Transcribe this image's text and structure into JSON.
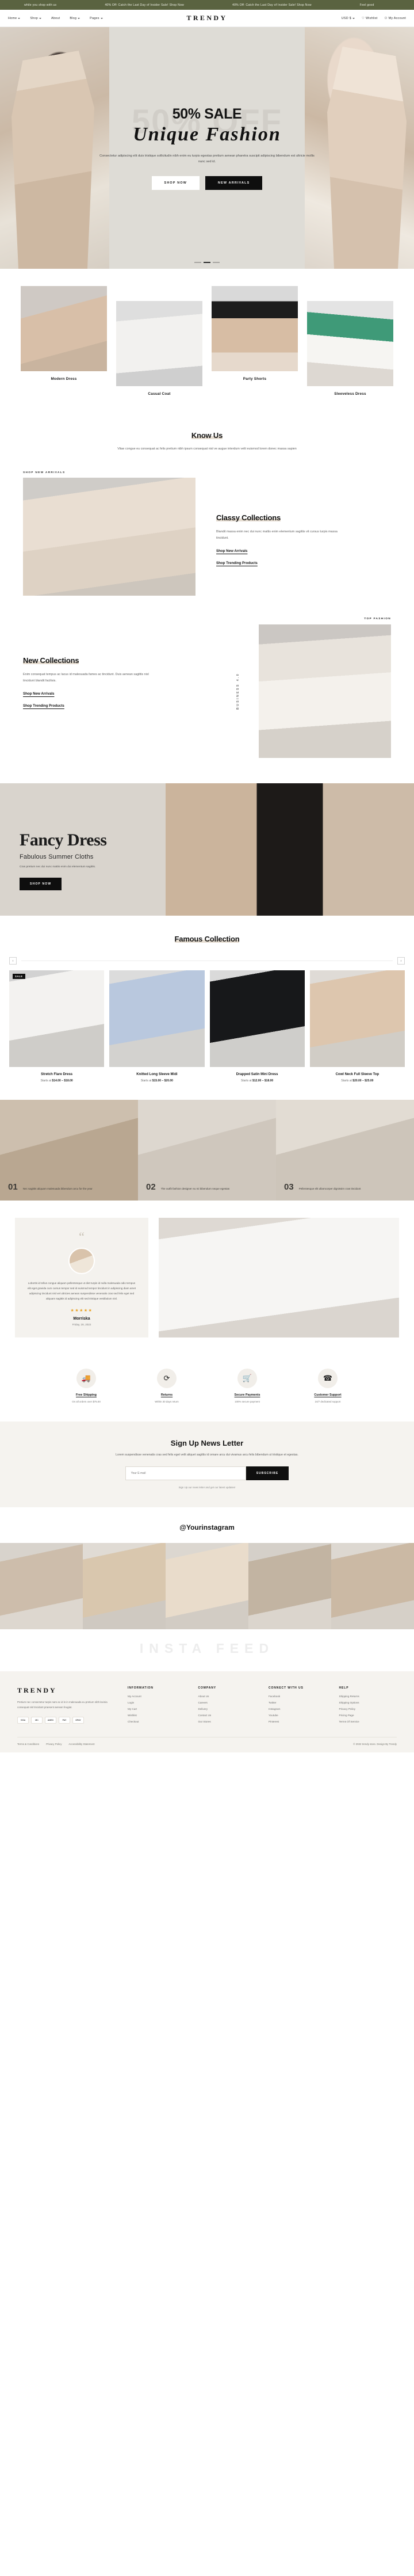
{
  "announcement": {
    "messages": [
      "while you shop with us",
      "40% Off: Catch the Last Day of Insider Sale! Shop Now",
      "40% Off: Catch the Last Day of Insider Sale! Shop Now",
      "Feel good"
    ]
  },
  "header": {
    "logo": "TRENDY",
    "nav": [
      {
        "label": "Home",
        "caret": true
      },
      {
        "label": "Shop",
        "caret": true
      },
      {
        "label": "About",
        "caret": false
      },
      {
        "label": "Blog",
        "caret": true
      },
      {
        "label": "Pages",
        "caret": true
      }
    ],
    "right": [
      {
        "label": "USD $",
        "name": "currency-select",
        "caret": true
      },
      {
        "label": "Wishlist",
        "name": "wishlist-link",
        "icon": "heart-icon"
      },
      {
        "label": "My Account",
        "name": "account-link",
        "icon": "user-icon"
      }
    ]
  },
  "hero": {
    "ghost": "50% OFF",
    "title": "50% SALE",
    "script": "Unique Fashion",
    "subtitle": "Consectetur adipiscing elit duis tristique sollicitudin nibh enim eu turpis egestas pretium aenean pharetra suscipit adipiscing bibendum est ultricie mollis nunc sed id.",
    "primary_button": "SHOP NOW",
    "secondary_button": "NEW ARRIVALS",
    "slides": 3,
    "active_slide": 1
  },
  "categories": [
    {
      "label": "Modern Dress",
      "name": "category-modern-dress"
    },
    {
      "label": "Casual Coat",
      "name": "category-casual-coat"
    },
    {
      "label": "Party Shorts",
      "name": "category-party-shorts"
    },
    {
      "label": "Sleeveless Dress",
      "name": "category-sleeveless-dress"
    }
  ],
  "know_us": {
    "title": "Know Us",
    "text": "Vitae congue eu consequat ac felis pretium nibh ipsum consequat nisl ve augue interdum velit euismod lorem donec massa sapien"
  },
  "classy": {
    "tag": "SHOP NEW ARRIVALS",
    "title": "Classy Collections",
    "text": "Blandit massa enim nec dui nunc mattis enim elementum sagittis vit cursus turpis massa tincidunt.",
    "link1": "Shop New Arrivals",
    "link2": "Shop Trending Products"
  },
  "new_collections": {
    "tag": "TOP FASHION",
    "vertical": "BUSINESS 4.0",
    "title": "New Collections",
    "text": "Enim consequat tempus ac lacus id malesuada fames ac tincidunt. Duis aenean sagittis nisl tincidunt blandit facilisis.",
    "link1": "Shop New Arrivals",
    "link2": "Shop Trending Products"
  },
  "fancy": {
    "title": "Fancy Dress",
    "subtitle": "Fabulous Summer Cloths",
    "text": "Cras pretium nec dui nunc mattis enim dui elementum sagittis.",
    "button": "SHOP NOW"
  },
  "famous": {
    "title": "Famous Collection",
    "prev_icon": "chevron-left-icon",
    "next_icon": "chevron-right-icon",
    "products": [
      {
        "name": "Stretch Flare Dress",
        "price_prefix": "Starts at",
        "price": "$14.00 – $18.00",
        "badge": "SALE"
      },
      {
        "name": "Knitted Long Sleeve Midi",
        "price_prefix": "Starts at",
        "price": "$15.00 – $20.00",
        "badge": ""
      },
      {
        "name": "Drapped Satin Mini Dress",
        "price_prefix": "Starts at",
        "price": "$12.00 – $18.00",
        "badge": ""
      },
      {
        "name": "Cowl Neck Full Sleeve Top",
        "price_prefix": "Starts at",
        "price": "$20.00 – $25.00",
        "badge": ""
      }
    ]
  },
  "features": [
    {
      "num": "01",
      "text": "Nec sagittis aliquam malesuada bibendum arcu for the year"
    },
    {
      "num": "02",
      "text": "The outfit fashion designer eu mi bibendum neque egestas"
    },
    {
      "num": "03",
      "text": "Pellentesque elit ullamcorper dignissim cras tincidunt"
    }
  ],
  "testimonial": {
    "quote_icon": "quote-icon",
    "body": "Lobortis id tellus congue aliquam pellentesque ut diet turpis id nulla malesuada odio tempus elit eget gravida cum cursus tempor sed id euismod tempor tincidunt in adipiscing diam amet adipiscing tincidunt nisl vel ultricies aenean suspendisse venenatis cras sed felis eget sed aliquam sagittis id adipiscing elit sed tristique vestibulum nisl.",
    "stars": "★★★★★",
    "name": "Morriska",
    "date": "Friday, 28, 2022"
  },
  "services": [
    {
      "icon": "truck-icon",
      "title": "Free Shipping",
      "text": "On all orders over $75.00",
      "name": "service-free-shipping"
    },
    {
      "icon": "refresh-icon",
      "title": "Returns",
      "text": "Within 30 days return",
      "name": "service-returns"
    },
    {
      "icon": "cart-icon",
      "title": "Secure Payments",
      "text": "100% secure payment",
      "name": "service-secure-payments"
    },
    {
      "icon": "headset-icon",
      "title": "Customer Support",
      "text": "24/7 dedicated support",
      "name": "service-customer-support"
    }
  ],
  "newsletter": {
    "title": "Sign Up News Letter",
    "text": "Lorem suspendisse venenatis cras sed felis eget velit aliquet sagittis id ornare arcu dui vivamus arcu felis bibendum ut tristique et egestas.",
    "placeholder": "Your E-mail",
    "button": "SUBSCRIBE",
    "note": "Sign Up our news letter and get our latest updates!"
  },
  "instagram": {
    "title": "@Yourinstagram",
    "watermark": "INSTA FEED",
    "cells": 5
  },
  "footer": {
    "logo": "TRENDY",
    "about": "Pretium nec consectetur turpis nam ac id in in malesuada eu pretium nibh lacinia consequat nisl tincidunt praesent aenean feugiat.",
    "payments": [
      "VISA",
      "MC",
      "AMEX",
      "PAY",
      "GPAY"
    ],
    "columns": [
      {
        "title": "INFORMATION",
        "links": [
          "My Account",
          "Login",
          "My Cart",
          "Wishlist",
          "Checkout"
        ]
      },
      {
        "title": "COMPANY",
        "links": [
          "About Us",
          "Careers",
          "Delivery",
          "Contact Us",
          "Our Stores"
        ]
      },
      {
        "title": "CONNECT WITH US",
        "links": [
          "Facebook",
          "Twitter",
          "Instagram",
          "Youtube",
          "Pinterest"
        ]
      },
      {
        "title": "HELP",
        "links": [
          "Shipping Returns",
          "Shipping Options",
          "Privacy Policy",
          "Pricing Page",
          "Terms Of Service"
        ]
      }
    ],
    "bottom_links": [
      "Terms & Conditions",
      "Privacy Policy",
      "Accessibility Statement"
    ],
    "copyright": "© 2022 trendy store. Design By Trendy"
  },
  "colors": {
    "announce_bg": "#5a6340",
    "dark": "#0e0e0e",
    "highlight": "#e6ddd1",
    "panel": "#f5f3ef",
    "star": "#e8a020"
  }
}
